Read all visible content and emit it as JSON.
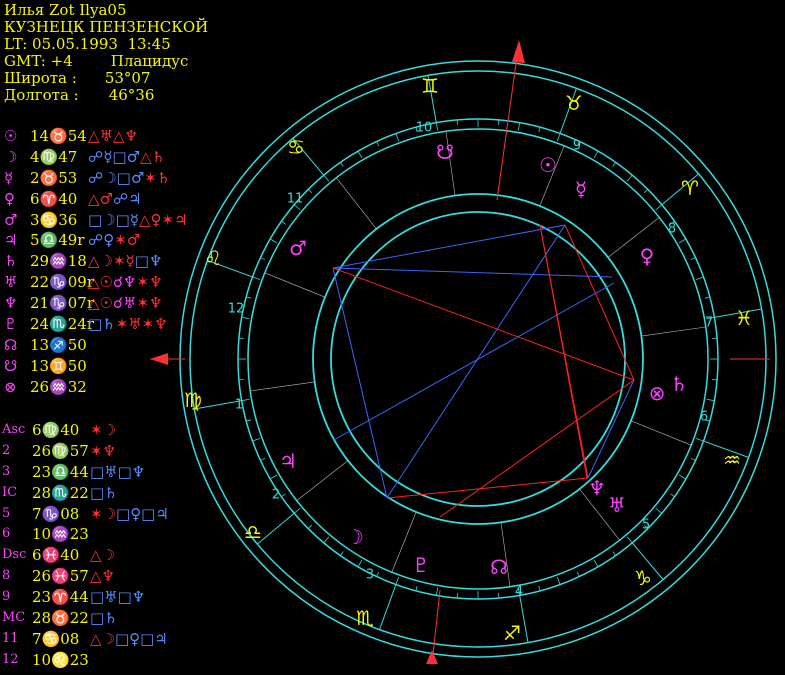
{
  "header": {
    "name": "Илья Zot Ilya05",
    "place": "КУЗНЕЦК ПЕНЗЕНСКОЙ",
    "lt": "LT: 05.05.1993  13:45",
    "gmt": "GMT: +4",
    "house_system": "Плацидус",
    "lat_label": "Широта :",
    "lat_value": "53°07",
    "lon_label": "Долгота :",
    "lon_value": "46°36"
  },
  "colors": {
    "text_yellow": "#f7f700",
    "symbol_magenta": "#ff40ff",
    "wheel_cyan": "#33dddd",
    "aspect_red": "#ff2020",
    "aspect_blue": "#3a66ff",
    "axis_red": "#ff3030"
  },
  "planet_table": [
    {
      "glyph": "☉",
      "pos": "14♉54",
      "aspects": [
        {
          "t": "△♅",
          "c": "red"
        },
        {
          "t": "△♆",
          "c": "red"
        }
      ]
    },
    {
      "glyph": "☽",
      "pos": "4♍47",
      "aspects": [
        {
          "t": "☍☿",
          "c": "blue"
        },
        {
          "t": "□♂",
          "c": "blue"
        },
        {
          "t": "△♄",
          "c": "red"
        }
      ]
    },
    {
      "glyph": "☿",
      "pos": "2♉53",
      "aspects": [
        {
          "t": "☍☽",
          "c": "blue"
        },
        {
          "t": "□♂",
          "c": "blue"
        },
        {
          "t": "✶♄",
          "c": "red"
        }
      ]
    },
    {
      "glyph": "♀",
      "pos": "6♈40",
      "aspects": [
        {
          "t": "△♂",
          "c": "red"
        },
        {
          "t": "☍♃",
          "c": "blue"
        }
      ]
    },
    {
      "glyph": "♂",
      "pos": "3♋36",
      "aspects": [
        {
          "t": "□☽",
          "c": "blue"
        },
        {
          "t": "□☿",
          "c": "blue"
        },
        {
          "t": "△♀",
          "c": "red"
        },
        {
          "t": "✶♃",
          "c": "red"
        }
      ]
    },
    {
      "glyph": "♃",
      "pos": "5♎49r",
      "aspects": [
        {
          "t": "☍♀",
          "c": "blue"
        },
        {
          "t": "✶♂",
          "c": "red"
        }
      ]
    },
    {
      "glyph": "♄",
      "pos": "29♒18",
      "aspects": [
        {
          "t": "△☽",
          "c": "red"
        },
        {
          "t": "✶☿",
          "c": "red"
        },
        {
          "t": "□♆",
          "c": "blue"
        }
      ]
    },
    {
      "glyph": "♅",
      "pos": "22♑09r",
      "aspects": [
        {
          "t": "△☉",
          "c": "red"
        },
        {
          "t": "☌♆",
          "c": "mag"
        },
        {
          "t": "✶♆",
          "c": "red"
        }
      ]
    },
    {
      "glyph": "♆",
      "pos": "21♑07r",
      "aspects": [
        {
          "t": "△☉",
          "c": "red"
        },
        {
          "t": "☌♅",
          "c": "mag"
        },
        {
          "t": "✶♆",
          "c": "red"
        }
      ]
    },
    {
      "glyph": "♇",
      "pos": "24♏24r",
      "aspects": [
        {
          "t": "□♄",
          "c": "blue"
        },
        {
          "t": "✶♅",
          "c": "red"
        },
        {
          "t": "✶♆",
          "c": "red"
        }
      ]
    },
    {
      "glyph": "☊",
      "pos": "13♐50",
      "aspects": []
    },
    {
      "glyph": "☋",
      "pos": "13♊50",
      "aspects": []
    },
    {
      "glyph": "⊗",
      "pos": "26♒32",
      "aspects": []
    }
  ],
  "cusp_table": [
    {
      "label": "Asc",
      "pos": "6♍40",
      "aspects": [
        {
          "t": "✶☽",
          "c": "red"
        }
      ]
    },
    {
      "label": "2",
      "pos": "26♍57",
      "aspects": [
        {
          "t": "✶♆",
          "c": "red"
        }
      ]
    },
    {
      "label": "3",
      "pos": "23♎44",
      "aspects": [
        {
          "t": "□♅",
          "c": "blue"
        },
        {
          "t": "□♆",
          "c": "blue"
        }
      ]
    },
    {
      "label": "IC",
      "pos": "28♏22",
      "aspects": [
        {
          "t": "□♄",
          "c": "blue"
        }
      ]
    },
    {
      "label": "5",
      "pos": "7♑08",
      "aspects": [
        {
          "t": "✶☽",
          "c": "red"
        },
        {
          "t": "□♀",
          "c": "blue"
        },
        {
          "t": "□♃",
          "c": "blue"
        }
      ]
    },
    {
      "label": "6",
      "pos": "10♒23",
      "aspects": []
    },
    {
      "label": "Dsc",
      "pos": "6♓40",
      "aspects": [
        {
          "t": "△☽",
          "c": "red"
        }
      ]
    },
    {
      "label": "8",
      "pos": "26♓57",
      "aspects": [
        {
          "t": "△♆",
          "c": "red"
        }
      ]
    },
    {
      "label": "9",
      "pos": "23♈44",
      "aspects": [
        {
          "t": "□♅",
          "c": "blue"
        },
        {
          "t": "□♆",
          "c": "blue"
        }
      ]
    },
    {
      "label": "MC",
      "pos": "28♉22",
      "aspects": [
        {
          "t": "□♄",
          "c": "blue"
        }
      ]
    },
    {
      "label": "11",
      "pos": "7♋08",
      "aspects": [
        {
          "t": "△☽",
          "c": "red"
        },
        {
          "t": "□♀",
          "c": "blue"
        },
        {
          "t": "□♃",
          "c": "blue"
        }
      ]
    },
    {
      "label": "12",
      "pos": "10♌23",
      "aspects": []
    }
  ],
  "wheel": {
    "signs": [
      {
        "glyph": "♊",
        "name": "gemini"
      },
      {
        "glyph": "♉",
        "name": "taurus"
      },
      {
        "glyph": "♈",
        "name": "aries"
      },
      {
        "glyph": "♓",
        "name": "pisces"
      },
      {
        "glyph": "♒",
        "name": "aquarius"
      },
      {
        "glyph": "♑",
        "name": "capricorn"
      },
      {
        "glyph": "♐",
        "name": "sagittarius"
      },
      {
        "glyph": "♏",
        "name": "scorpio"
      },
      {
        "glyph": "♎",
        "name": "libra"
      },
      {
        "glyph": "♍",
        "name": "virgo"
      },
      {
        "glyph": "♌",
        "name": "leo"
      },
      {
        "glyph": "♋",
        "name": "cancer"
      }
    ],
    "house_numbers": [
      "10",
      "9",
      "8",
      "7",
      "6",
      "5",
      "4",
      "3",
      "2",
      "1",
      "12",
      "11"
    ],
    "planet_glyphs": [
      {
        "glyph": "☋",
        "name": "south-node"
      },
      {
        "glyph": "☉",
        "name": "sun"
      },
      {
        "glyph": "☿",
        "name": "mercury"
      },
      {
        "glyph": "♀",
        "name": "venus"
      },
      {
        "glyph": "⊗",
        "name": "part-of-fortune"
      },
      {
        "glyph": "♄",
        "name": "saturn"
      },
      {
        "glyph": "♆",
        "name": "neptune"
      },
      {
        "glyph": "♅",
        "name": "uranus"
      },
      {
        "glyph": "☊",
        "name": "north-node"
      },
      {
        "glyph": "♇",
        "name": "pluto"
      },
      {
        "glyph": "☽",
        "name": "moon"
      },
      {
        "glyph": "♃",
        "name": "jupiter"
      },
      {
        "glyph": "♂",
        "name": "mars"
      }
    ]
  }
}
